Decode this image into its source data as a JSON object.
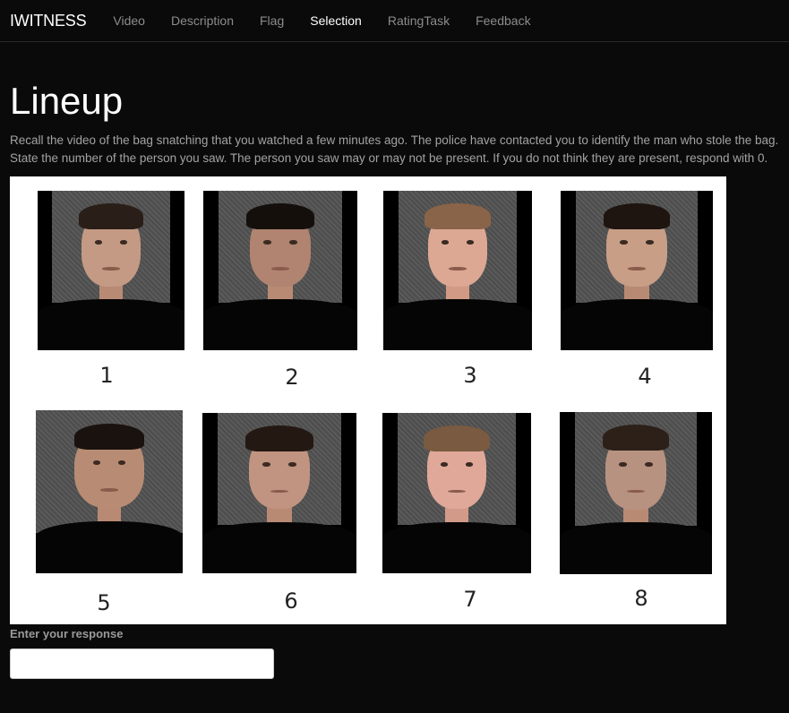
{
  "navbar": {
    "brand": "IWITNESS",
    "items": [
      {
        "label": "Video",
        "active": false
      },
      {
        "label": "Description",
        "active": false
      },
      {
        "label": "Flag",
        "active": false
      },
      {
        "label": "Selection",
        "active": true
      },
      {
        "label": "RatingTask",
        "active": false
      },
      {
        "label": "Feedback",
        "active": false
      }
    ]
  },
  "main": {
    "title": "Lineup",
    "instructions": "Recall the video of the bag snatching that you watched a few minutes ago. The police have contacted you to identify the man who stole the bag. State the number of the person you saw. The person you saw may or may not be present. If you do not think they are present, respond with 0.",
    "lineup": {
      "numbers": [
        "1",
        "2",
        "3",
        "4",
        "5",
        "6",
        "7",
        "8"
      ]
    },
    "response": {
      "label": "Enter your response",
      "value": "",
      "placeholder": ""
    }
  }
}
